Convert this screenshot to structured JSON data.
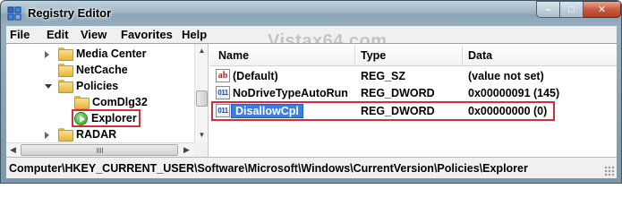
{
  "window": {
    "title": "Registry Editor",
    "watermark": "Vistax64.com"
  },
  "title_controls": {
    "minimize": "–",
    "maximize": "□",
    "close": "✕"
  },
  "menu": [
    "File",
    "Edit",
    "View",
    "Favorites",
    "Help"
  ],
  "tree": {
    "items": [
      {
        "label": "Media Center",
        "expander": "collapsed"
      },
      {
        "label": "NetCache",
        "expander": "none"
      },
      {
        "label": "Policies",
        "expander": "expanded"
      },
      {
        "label": "ComDlg32",
        "expander": "none"
      },
      {
        "label": "Explorer",
        "expander": "none",
        "highlighted": true
      },
      {
        "label": "RADAR",
        "expander": "collapsed"
      }
    ]
  },
  "values_list": {
    "columns": [
      "Name",
      "Type",
      "Data"
    ],
    "rows": [
      {
        "icon": "string-value-icon",
        "name": "(Default)",
        "type": "REG_SZ",
        "data": "(value not set)"
      },
      {
        "icon": "binary-value-icon",
        "name": "NoDriveTypeAutoRun",
        "type": "REG_DWORD",
        "data": "0x00000091 (145)"
      },
      {
        "icon": "binary-value-icon",
        "name": "DisallowCpl",
        "type": "REG_DWORD",
        "data": "0x00000000 (0)",
        "selected": true
      }
    ]
  },
  "status_bar": {
    "path": "Computer\\HKEY_CURRENT_USER\\Software\\Microsoft\\Windows\\CurrentVersion\\Policies\\Explorer"
  },
  "colors": {
    "selection": "#3a7ee0",
    "highlight_outline": "#d0303a",
    "folder": "#e6b43c"
  }
}
